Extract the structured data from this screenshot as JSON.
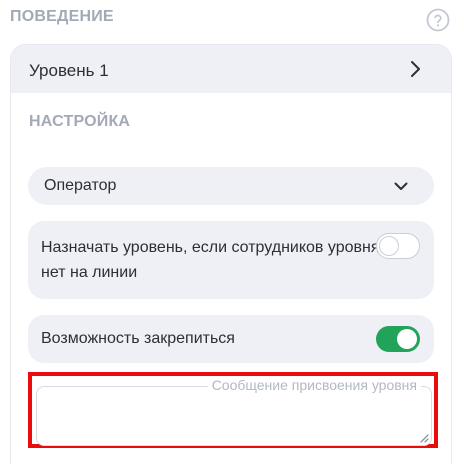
{
  "behavior": {
    "section_title": "ПОВЕДЕНИЕ",
    "help_icon": "question-circle-icon"
  },
  "level": {
    "label": "Уровень 1",
    "chevron_icon": "chevron-right-icon"
  },
  "settings": {
    "section_title": "НАСТРОЙКА",
    "operator_select": {
      "selected": "Оператор",
      "chevron_icon": "chevron-down-icon"
    },
    "assign_level": {
      "label": "Назначать уровень, если сотрудников уровня нет на линии",
      "enabled": false
    },
    "pin_option": {
      "label": "Возможность закрепиться",
      "enabled": true
    },
    "message_field": {
      "label": "Сообщение присвоения уровня",
      "value": ""
    }
  },
  "colors": {
    "accent_green": "#22a35a",
    "highlight_red": "#ea0b0b",
    "card_bg": "#eef0f5",
    "muted_text": "#a3a9b6"
  }
}
